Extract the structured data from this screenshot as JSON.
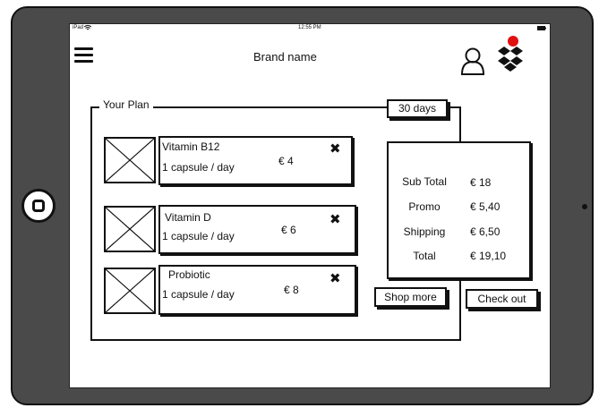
{
  "status_bar": {
    "device": "iPad",
    "time": "12:55 PM"
  },
  "header": {
    "brand": "Brand name"
  },
  "plan": {
    "title": "Your Plan",
    "duration_button": "30 days",
    "items": [
      {
        "name": "Vitamin B12",
        "dose": "1 capsule / day",
        "price": "€ 4"
      },
      {
        "name": "Vitamin D",
        "dose": "1 capsule / day",
        "price": "€ 6"
      },
      {
        "name": "Probiotic",
        "dose": "1 capsule / day",
        "price": "€ 8"
      }
    ],
    "remove_glyph": "✖"
  },
  "summary": {
    "rows": [
      {
        "label": "Sub Total",
        "value": "€ 18"
      },
      {
        "label": "Promo",
        "value": "€ 5,40"
      },
      {
        "label": "Shipping",
        "value": "€ 6,50"
      },
      {
        "label": "Total",
        "value": "€ 19,10"
      }
    ]
  },
  "actions": {
    "shop_more": "Shop more",
    "check_out": "Check out"
  },
  "colors": {
    "frame": "#4a4a4a",
    "notification": "#e01010",
    "ink": "#111111"
  }
}
